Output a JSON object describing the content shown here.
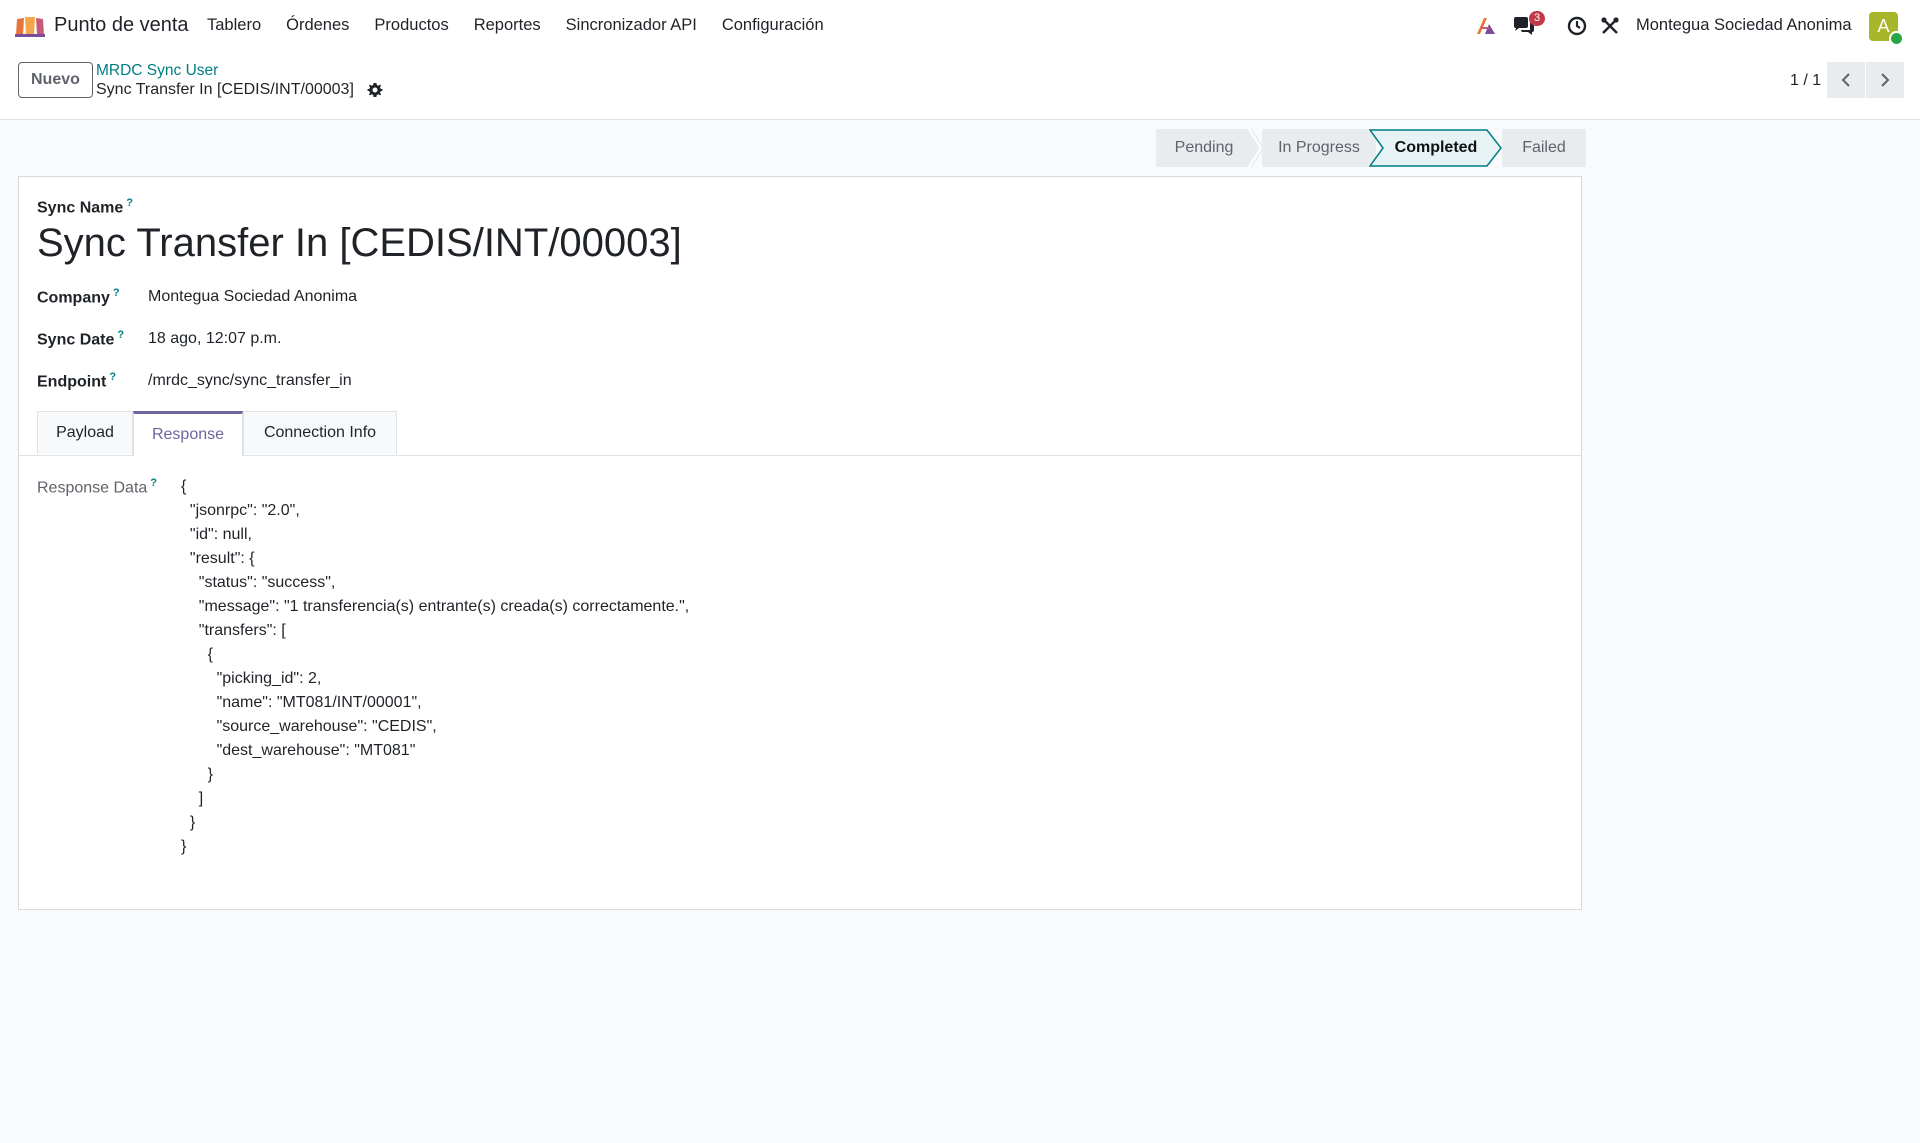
{
  "navbar": {
    "app_name": "Punto de venta",
    "menu": [
      "Tablero",
      "Órdenes",
      "Productos",
      "Reportes",
      "Sincronizador API",
      "Configuración"
    ],
    "messages_count": "3",
    "company": "Montegua Sociedad Anonima",
    "avatar_initial": "A"
  },
  "control_panel": {
    "new_button": "Nuevo",
    "breadcrumb_parent": "MRDC Sync User",
    "breadcrumb_current": "Sync Transfer In [CEDIS/INT/00003]",
    "pager": "1 / 1"
  },
  "statusbar": {
    "stages": [
      "Pending",
      "In Progress",
      "Completed",
      "Failed"
    ],
    "active": "Completed"
  },
  "form": {
    "sync_name_label": "Sync Name",
    "title": "Sync Transfer In [CEDIS/INT/00003]",
    "company_label": "Company",
    "company_value": "Montegua Sociedad Anonima",
    "sync_date_label": "Sync Date",
    "sync_date_value": "18 ago, 12:07 p.m.",
    "endpoint_label": "Endpoint",
    "endpoint_value": "/mrdc_sync/sync_transfer_in",
    "help_marker": "?",
    "tabs": [
      "Payload",
      "Response",
      "Connection Info"
    ],
    "active_tab": "Response",
    "response_label": "Response Data",
    "response_data": "{\n  \"jsonrpc\": \"2.0\",\n  \"id\": null,\n  \"result\": {\n    \"status\": \"success\",\n    \"message\": \"1 transferencia(s) entrante(s) creada(s) correctamente.\",\n    \"transfers\": [\n      {\n        \"picking_id\": 2,\n        \"name\": \"MT081/INT/00001\",\n        \"source_warehouse\": \"CEDIS\",\n        \"dest_warehouse\": \"MT081\"\n      }\n    ]\n  }\n}"
  },
  "colors": {
    "accent": "#71639e",
    "link": "#017e84",
    "avatar": "#a8b62a",
    "badge": "#c23a4a"
  }
}
